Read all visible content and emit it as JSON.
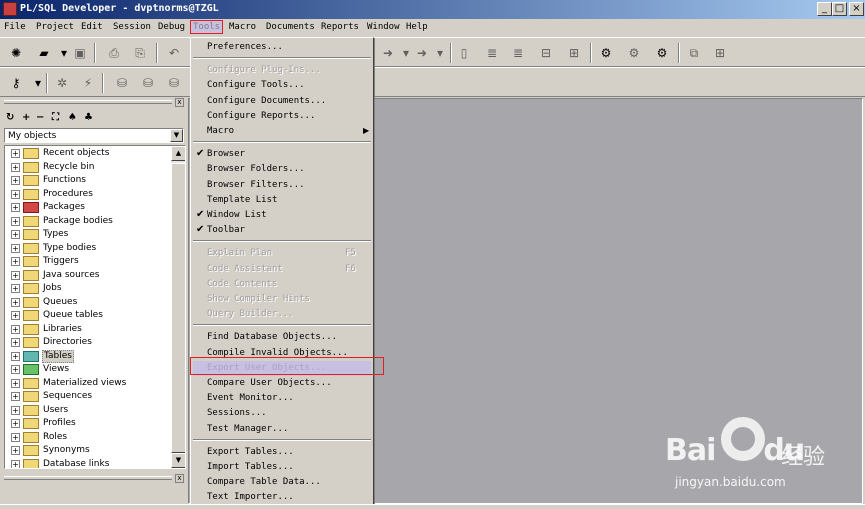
{
  "window": {
    "title": "PL/SQL Developer - dvptnorms@TZGL",
    "min_glyph": "_",
    "max_glyph": "□",
    "close_glyph": "×"
  },
  "menubar": {
    "items": [
      "File",
      "Project",
      "Edit",
      "Session",
      "Debug",
      "Tools",
      "Macro",
      "Documents",
      "Reports",
      "Window",
      "Help"
    ]
  },
  "object_browser": {
    "close_glyph": "x",
    "selector_value": "My objects",
    "tree_items": [
      {
        "label": "Recent objects",
        "color": "yellow"
      },
      {
        "label": "Recycle bin",
        "color": "yellow"
      },
      {
        "label": "Functions",
        "color": "yellow"
      },
      {
        "label": "Procedures",
        "color": "yellow"
      },
      {
        "label": "Packages",
        "color": "red"
      },
      {
        "label": "Package bodies",
        "color": "yellow"
      },
      {
        "label": "Types",
        "color": "yellow"
      },
      {
        "label": "Type bodies",
        "color": "yellow"
      },
      {
        "label": "Triggers",
        "color": "yellow"
      },
      {
        "label": "Java sources",
        "color": "yellow"
      },
      {
        "label": "Jobs",
        "color": "yellow"
      },
      {
        "label": "Queues",
        "color": "yellow"
      },
      {
        "label": "Queue tables",
        "color": "yellow"
      },
      {
        "label": "Libraries",
        "color": "yellow"
      },
      {
        "label": "Directories",
        "color": "yellow"
      },
      {
        "label": "Tables",
        "color": "teal",
        "selected": true
      },
      {
        "label": "Views",
        "color": "green"
      },
      {
        "label": "Materialized views",
        "color": "yellow"
      },
      {
        "label": "Sequences",
        "color": "yellow"
      },
      {
        "label": "Users",
        "color": "yellow"
      },
      {
        "label": "Profiles",
        "color": "yellow"
      },
      {
        "label": "Roles",
        "color": "yellow"
      },
      {
        "label": "Synonyms",
        "color": "yellow"
      },
      {
        "label": "Database links",
        "color": "yellow"
      }
    ]
  },
  "tools_menu": {
    "groups": [
      [
        {
          "label": "Preferences...",
          "enabled": true
        }
      ],
      [
        {
          "label": "Configure Plug-Ins...",
          "enabled": false
        },
        {
          "label": "Configure Tools...",
          "enabled": true
        },
        {
          "label": "Configure Documents...",
          "enabled": true
        },
        {
          "label": "Configure Reports...",
          "enabled": true
        },
        {
          "label": "Macro",
          "enabled": true,
          "submenu": true
        }
      ],
      [
        {
          "label": "Browser",
          "enabled": true,
          "checked": true
        },
        {
          "label": "Browser Folders...",
          "enabled": true
        },
        {
          "label": "Browser Filters...",
          "enabled": true
        },
        {
          "label": "Template List",
          "enabled": true
        },
        {
          "label": "Window List",
          "enabled": true,
          "checked": true
        },
        {
          "label": "Toolbar",
          "enabled": true,
          "checked": true
        }
      ],
      [
        {
          "label": "Explain Plan",
          "enabled": false,
          "shortcut": "F5"
        },
        {
          "label": "Code Assistant",
          "enabled": false,
          "shortcut": "F6"
        },
        {
          "label": "Code Contents",
          "enabled": false
        },
        {
          "label": "Show Compiler Hints",
          "enabled": false
        },
        {
          "label": "Query Builder...",
          "enabled": false
        }
      ],
      [
        {
          "label": "Find Database Objects...",
          "enabled": true
        },
        {
          "label": "Compile Invalid Objects...",
          "enabled": true
        },
        {
          "label": "Export User Objects...",
          "enabled": true,
          "highlighted": true
        },
        {
          "label": "Compare User Objects...",
          "enabled": true
        },
        {
          "label": "Event Monitor...",
          "enabled": true
        },
        {
          "label": "Sessions...",
          "enabled": true
        },
        {
          "label": "Test Manager...",
          "enabled": true
        }
      ],
      [
        {
          "label": "Export Tables...",
          "enabled": true
        },
        {
          "label": "Import Tables...",
          "enabled": true
        },
        {
          "label": "Compare Table Data...",
          "enabled": true
        },
        {
          "label": "Text Importer...",
          "enabled": true
        }
      ]
    ],
    "check_glyph": "✔",
    "submenu_glyph": "▶"
  },
  "watermark": {
    "brand_left": "Bai",
    "brand_right": "du",
    "brand_cn": "经验",
    "url": "jingyan.baidu.com"
  },
  "colors": {
    "titlebar_start": "#0a246a",
    "titlebar_end": "#a6caf0",
    "workspace": "#a7a6aa",
    "highlight_box": "#e02020",
    "menu_highlight": "#c8c0e0"
  }
}
